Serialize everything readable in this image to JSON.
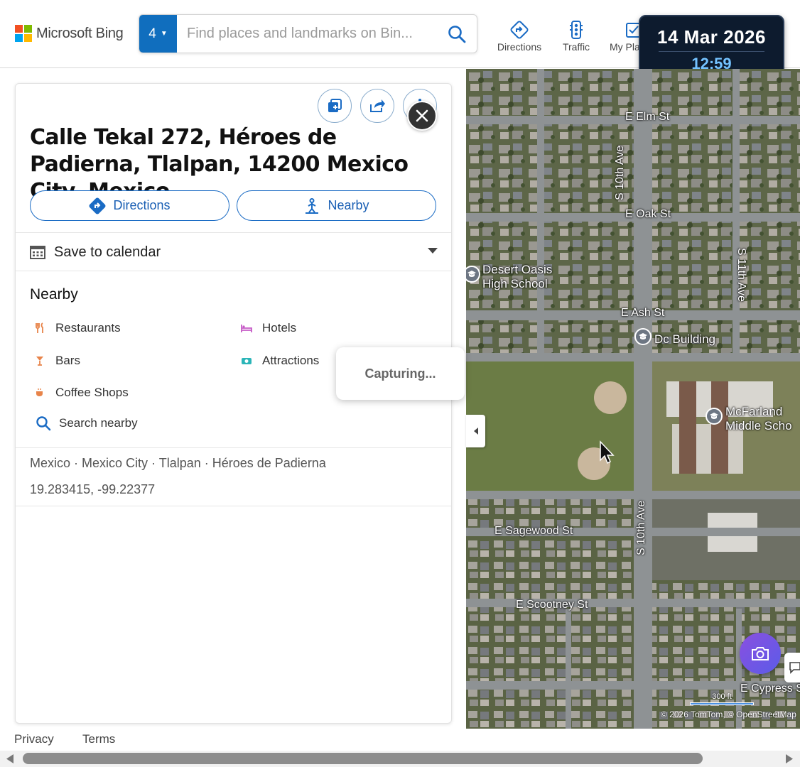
{
  "header": {
    "logo_text": "Microsoft Bing",
    "search": {
      "badge": "4",
      "placeholder": "Find places and landmarks on Bin..."
    },
    "nav": {
      "directions": "Directions",
      "traffic": "Traffic",
      "my_places": "My Pla"
    },
    "datetime": {
      "date": "14 Mar 2026",
      "time": "12:59"
    }
  },
  "panel": {
    "address": "Calle Tekal 272, Héroes de Padierna, Tlalpan, 14200 Mexico City, Mexico",
    "directions_label": "Directions",
    "nearby_label": "Nearby",
    "calendar_label": "Save to calendar",
    "nearby_title": "Nearby",
    "nearby_items": {
      "restaurants": "Restaurants",
      "hotels": "Hotels",
      "bars": "Bars",
      "attractions": "Attractions",
      "coffee": "Coffee Shops",
      "search": "Search nearby"
    },
    "breadcrumb": "Mexico · Mexico City · Tlalpan · Héroes de Padierna",
    "coords": "19.283415, -99.22377"
  },
  "map": {
    "streets": {
      "elm": "E Elm St",
      "oak": "E Oak St",
      "ash": "E Ash St",
      "sagewood": "E Sagewood St",
      "scootney": "E Scootney St",
      "cypress": "E Cypress S",
      "tenth_a": "S 10th Ave",
      "tenth_b": "S 10th Ave",
      "eleventh": "S 11th Ave"
    },
    "pois": {
      "desert_oasis_1": "Desert Oasis",
      "desert_oasis_2": "High School",
      "dc_building": "Dc Building",
      "mcfarland_1": "McFarland",
      "mcfarland_2": "Middle Scho"
    },
    "scale": "300 ft",
    "copyright": "© 2026 TomTom, © OpenStreetMap"
  },
  "capturing": "Capturing...",
  "footer": {
    "privacy": "Privacy",
    "terms": "Terms"
  },
  "colors": {
    "accent": "#1a6bc4",
    "bing_blue": "#106ebe",
    "datetime_bg": "#0d1b2e",
    "time_color": "#74c2ff"
  }
}
